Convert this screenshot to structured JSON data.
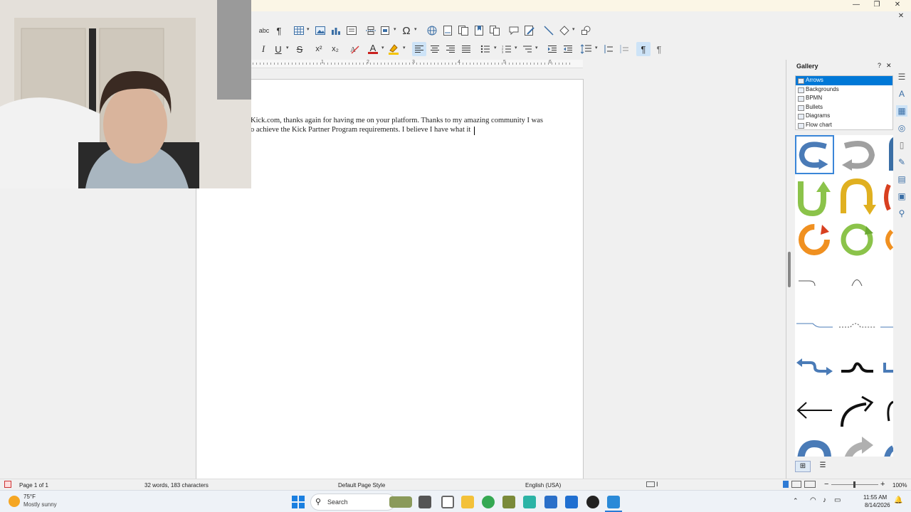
{
  "window": {
    "minimize": "—",
    "restore": "❐",
    "close": "✕",
    "doc_close": "✕"
  },
  "document": {
    "line1": "Kick.com, thanks again for having me on your platform. Thanks to my amazing community I was",
    "line2": "o achieve the Kick Partner Program requirements. I believe I have what it"
  },
  "ruler": {
    "numbers": [
      "1",
      "2",
      "3",
      "4",
      "5",
      "6"
    ]
  },
  "toolbar1": {
    "icons": [
      "spellcheck-icon",
      "pilcrow-icon",
      "table-icon",
      "image-icon",
      "chart-icon",
      "textbox-icon",
      "page-break-icon",
      "field-icon",
      "special-char-icon",
      "hyperlink-icon",
      "footnote-icon",
      "endnote-icon",
      "bookmark-icon",
      "cross-ref-icon",
      "comment-icon",
      "track-changes-icon",
      "line-icon",
      "shapes-icon",
      "draw-icon"
    ]
  },
  "toolbar2": {
    "italic": "I",
    "underline": "U",
    "strike": "S",
    "superscript": "x²",
    "subscript": "x₂",
    "font_color_label": "A"
  },
  "gallery": {
    "title": "Gallery",
    "help": "?",
    "close": "✕",
    "themes": [
      "Arrows",
      "Backgrounds",
      "BPMN",
      "Bullets",
      "Diagrams",
      "Flow chart"
    ],
    "selected": "Arrows",
    "colors": {
      "blue": "#4a7bb7",
      "gray": "#a0a0a0",
      "green": "#8bc34a",
      "yellow": "#e0b020",
      "orange": "#f09020",
      "red": "#d84020"
    }
  },
  "status": {
    "page": "Page 1 of 1",
    "words": "32 words, 183 characters",
    "style": "Default Page Style",
    "language": "English (USA)",
    "zoom": "100%"
  },
  "taskbar": {
    "weather_temp": "75°F",
    "weather_desc": "Mostly sunny",
    "search": "Search",
    "time": "11:55 AM",
    "date": "8/14/2026"
  }
}
